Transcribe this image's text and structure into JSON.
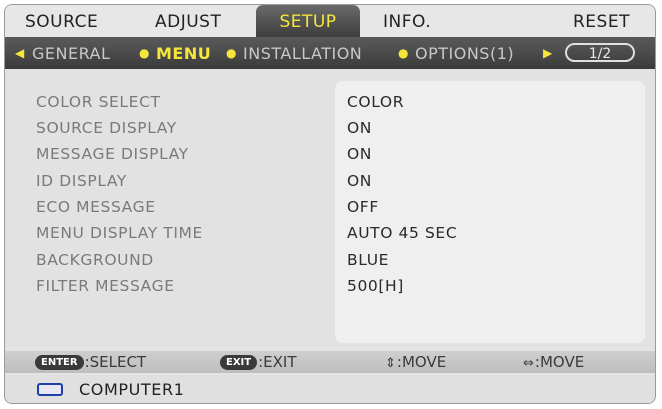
{
  "tabs": [
    "SOURCE",
    "ADJUST",
    "SETUP",
    "INFO.",
    "RESET"
  ],
  "subtabs": [
    "GENERAL",
    "MENU",
    "INSTALLATION",
    "OPTIONS(1)"
  ],
  "page_indicator": "1/2",
  "settings": [
    {
      "label": "COLOR SELECT",
      "value": "COLOR"
    },
    {
      "label": "SOURCE DISPLAY",
      "value": "ON"
    },
    {
      "label": "MESSAGE DISPLAY",
      "value": "ON"
    },
    {
      "label": "ID DISPLAY",
      "value": "ON"
    },
    {
      "label": "ECO MESSAGE",
      "value": "OFF"
    },
    {
      "label": "MENU DISPLAY TIME",
      "value": "AUTO 45 SEC"
    },
    {
      "label": "BACKGROUND",
      "value": "BLUE"
    },
    {
      "label": "FILTER MESSAGE",
      "value": "500[H]"
    }
  ],
  "hints": {
    "enter_key": "ENTER",
    "enter_text": ":SELECT",
    "exit_key": "EXIT",
    "exit_text": ":EXIT",
    "updown_text": ":MOVE",
    "leftright_text": ":MOVE"
  },
  "source": "COMPUTER1",
  "colors": {
    "active_highlight": "#f6e53a",
    "tab_background": "#e7e7e7",
    "subbar_background": "#4a4a4a",
    "source_icon": "#1f3fa8"
  },
  "icons": {
    "updown": "up-down-arrow-icon",
    "leftright": "left-right-arrow-icon",
    "source": "monitor-icon"
  }
}
